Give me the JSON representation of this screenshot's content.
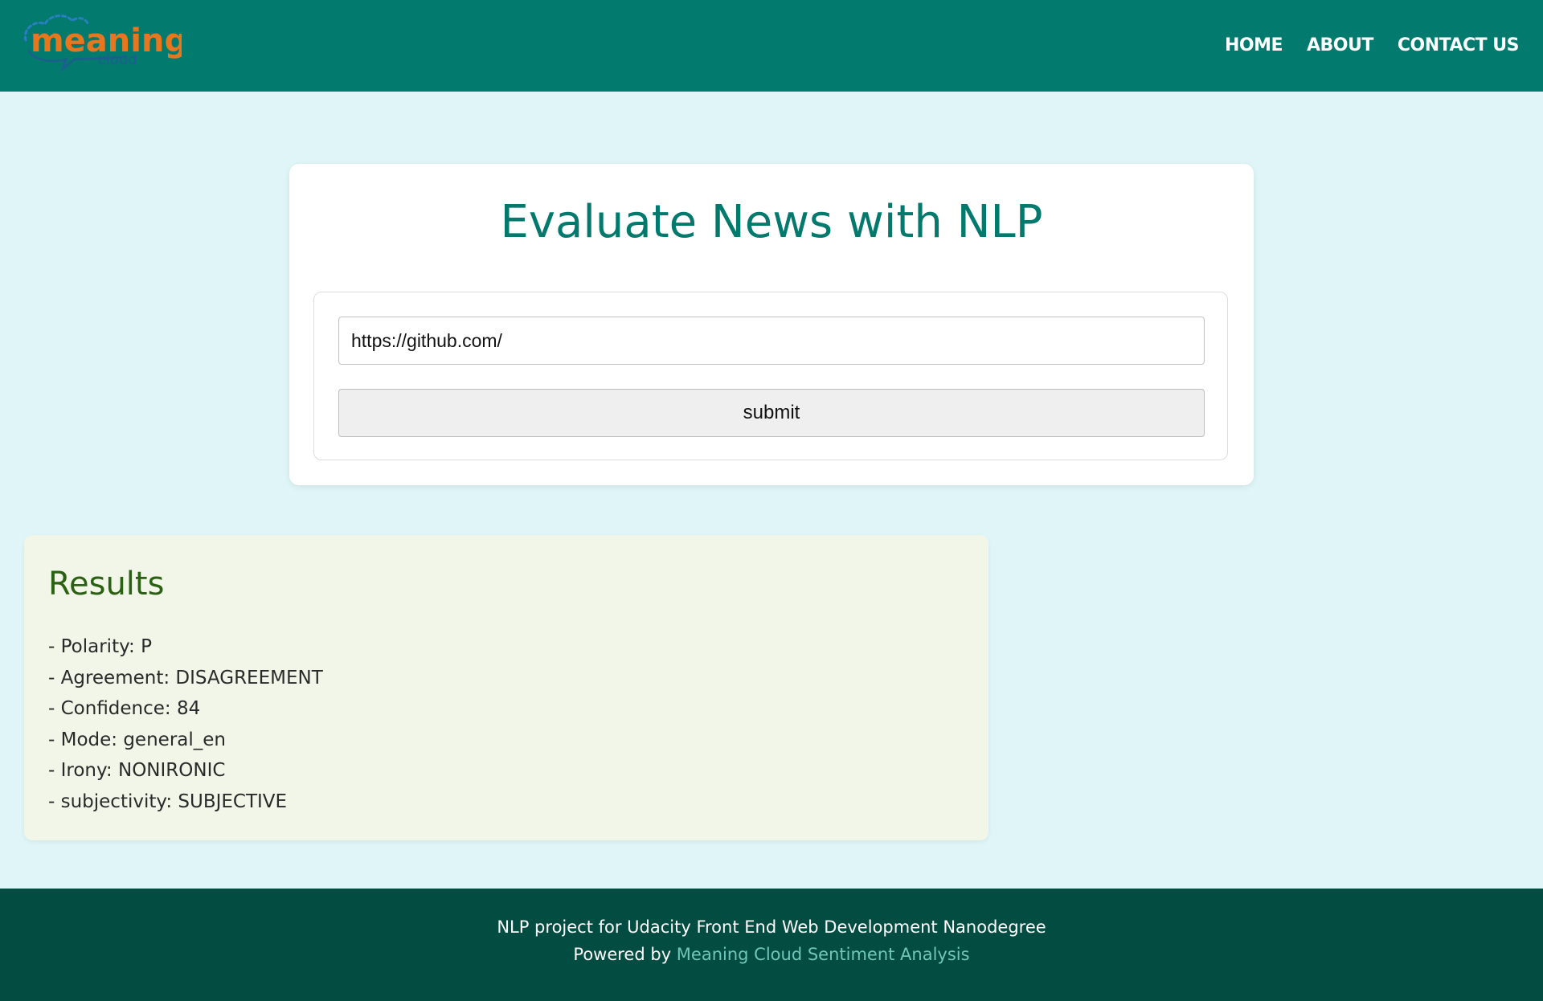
{
  "header": {
    "logo": {
      "name": "meaning",
      "sub": "cloud"
    },
    "nav": [
      {
        "label": "HOME"
      },
      {
        "label": "ABOUT"
      },
      {
        "label": "CONTACT US"
      }
    ]
  },
  "main": {
    "title": "Evaluate News with NLP",
    "url_input_value": "https://github.com/",
    "submit_label": "submit"
  },
  "results": {
    "title": "Results",
    "items": [
      "- Polarity: P",
      "- Agreement: DISAGREEMENT",
      "- Confidence: 84",
      "- Mode: general_en",
      "- Irony: NONIRONIC",
      "- subjectivity: SUBJECTIVE"
    ]
  },
  "footer": {
    "line1": "NLP project for Udacity Front End Web Development Nanodegree",
    "powered_prefix": "Powered by ",
    "powered_link": "Meaning Cloud Sentiment Analysis"
  },
  "colors": {
    "header_bg": "#027a6e",
    "page_bg": "#dff5f7",
    "title": "#02796d",
    "results_bg": "#f1f6e8",
    "results_title": "#2b6112",
    "footer_bg": "#024c41",
    "footer_link": "#6fc7b8",
    "logo_orange": "#e8761c",
    "logo_blue": "#2a7fc1"
  }
}
